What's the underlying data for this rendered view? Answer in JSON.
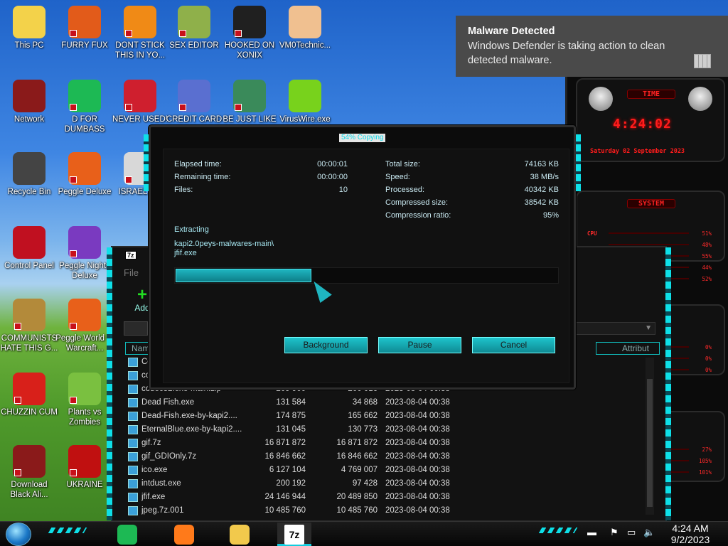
{
  "desktop_icons": [
    {
      "label": "This PC",
      "color": "#f3d24a",
      "shortcut": false
    },
    {
      "label": "FURRY FUX",
      "color": "#e25b1a",
      "shortcut": true
    },
    {
      "label": "DONT STICK THIS IN YO...",
      "color": "#f08a16",
      "shortcut": true
    },
    {
      "label": "SEX EDITOR",
      "color": "#8fb04a",
      "shortcut": true
    },
    {
      "label": "HOOKED ON XONIX",
      "color": "#202020",
      "shortcut": true
    },
    {
      "label": "VM0Technic...",
      "color": "#f0c090",
      "shortcut": false
    },
    {
      "label": "Network",
      "color": "#8a1a1a",
      "shortcut": false
    },
    {
      "label": "D FOR DUMBASS",
      "color": "#1db954",
      "shortcut": true
    },
    {
      "label": "NEVER USED!",
      "color": "#cf1f2e",
      "shortcut": true
    },
    {
      "label": "CREDIT CARD",
      "color": "#5a6fd0",
      "shortcut": true
    },
    {
      "label": "BE JUST LIKE",
      "color": "#3a8a5a",
      "shortcut": true
    },
    {
      "label": "VirusWire.exe",
      "color": "#78d21c",
      "shortcut": false
    },
    {
      "label": "Recycle Bin",
      "color": "#444444",
      "shortcut": false
    },
    {
      "label": "Peggle Deluxe",
      "color": "#e8601a",
      "shortcut": true
    },
    {
      "label": "ISRAEL S...",
      "color": "#d8d8d8",
      "shortcut": true
    },
    {
      "label": "Control Panel",
      "color": "#c01020",
      "shortcut": false
    },
    {
      "label": "Peggle Nights Deluxe",
      "color": "#7a3ac0",
      "shortcut": true
    },
    {
      "label": "COMMUNISTS HATE THIS G...",
      "color": "#b38a3a",
      "shortcut": true
    },
    {
      "label": "Peggle World of Warcraft...",
      "color": "#e8601a",
      "shortcut": true
    },
    {
      "label": "CHUZZIN CUM",
      "color": "#d8201a",
      "shortcut": true
    },
    {
      "label": "Plants vs Zombies",
      "color": "#7ac040",
      "shortcut": true
    },
    {
      "label": "Download Black Ali...",
      "color": "#8a1a1a",
      "shortcut": true
    },
    {
      "label": "UKRAINE",
      "color": "#c01010",
      "shortcut": true
    }
  ],
  "notification": {
    "title": "Malware Detected",
    "body": "Windows Defender is taking action to clean detected malware."
  },
  "gadget": {
    "time_label": "TIME",
    "clock": "4:24:02",
    "date": "Saturday 02 September 2023",
    "system_label": "SYSTEM",
    "cpu_label": "CPU",
    "rows": [
      {
        "label": "CPU",
        "value": "51%"
      },
      {
        "label": "",
        "value": "48%"
      },
      {
        "label": "",
        "value": "55%"
      },
      {
        "label": "",
        "value": "44%"
      },
      {
        "label": "",
        "value": "52%"
      },
      {
        "label": "",
        "value": "0%"
      },
      {
        "label": "",
        "value": "0%"
      },
      {
        "label": "",
        "value": "0%"
      },
      {
        "label": "",
        "value": "27%"
      },
      {
        "label": "",
        "value": "105%"
      },
      {
        "label": "",
        "value": "101%"
      }
    ]
  },
  "file_manager": {
    "app_badge": "7z",
    "menu_first": "File",
    "add_label": "Add",
    "col_name": "Name",
    "col_attrib": "Attribut",
    "files": [
      {
        "name": "Co...",
        "size": "",
        "packed": "",
        "modified": ""
      },
      {
        "name": "co...",
        "size": "",
        "packed": "",
        "modified": ""
      },
      {
        "name": "codec32.exe-main.zip",
        "size": "209 900",
        "packed": "200 016",
        "modified": "2023-08-04 00:38"
      },
      {
        "name": "Dead Fish.exe",
        "size": "131 584",
        "packed": "34 868",
        "modified": "2023-08-04 00:38"
      },
      {
        "name": "Dead-Fish.exe-by-kapi2....",
        "size": "174 875",
        "packed": "165 662",
        "modified": "2023-08-04 00:38"
      },
      {
        "name": "EternalBlue.exe-by-kapi2....",
        "size": "131 045",
        "packed": "130 773",
        "modified": "2023-08-04 00:38"
      },
      {
        "name": "gif.7z",
        "size": "16 871 872",
        "packed": "16 871 872",
        "modified": "2023-08-04 00:38"
      },
      {
        "name": "gif_GDIOnly.7z",
        "size": "16 846 662",
        "packed": "16 846 662",
        "modified": "2023-08-04 00:38"
      },
      {
        "name": "ico.exe",
        "size": "6 127 104",
        "packed": "4 769 007",
        "modified": "2023-08-04 00:38"
      },
      {
        "name": "intdust.exe",
        "size": "200 192",
        "packed": "97 428",
        "modified": "2023-08-04 00:38"
      },
      {
        "name": "jfif.exe",
        "size": "24 146 944",
        "packed": "20 489 850",
        "modified": "2023-08-04 00:38"
      },
      {
        "name": "jpeg.7z.001",
        "size": "10 485 760",
        "packed": "10 485 760",
        "modified": "2023-08-04 00:38"
      }
    ]
  },
  "progress": {
    "title": "54% Copying",
    "elapsed_label": "Elapsed time:",
    "elapsed": "00:00:01",
    "remaining_label": "Remaining time:",
    "remaining": "00:00:00",
    "files_label": "Files:",
    "files": "10",
    "total_label": "Total size:",
    "total": "74163 KB",
    "speed_label": "Speed:",
    "speed": "38 MB/s",
    "processed_label": "Processed:",
    "processed": "40342 KB",
    "compressed_label": "Compressed size:",
    "compressed": "38542 KB",
    "ratio_label": "Compression ratio:",
    "ratio": "95%",
    "action": "Extracting",
    "path_line1": "kapi2.0peys-malwares-main\\",
    "path_line2": "jfif.exe",
    "percent": 0.355,
    "background_btn": "Background",
    "pause_btn": "Pause",
    "cancel_btn": "Cancel"
  },
  "taskbar": {
    "time": "4:24 AM",
    "date": "9/2/2023",
    "active_app": "7z",
    "apps": [
      {
        "name": "spotify-icon",
        "color": "#1db954"
      },
      {
        "name": "firefox-icon",
        "color": "#ff7a1a"
      },
      {
        "name": "file-explorer-icon",
        "color": "#f2c94c"
      },
      {
        "name": "7zip-icon",
        "color": "#ffffff"
      }
    ]
  },
  "colors": {
    "accent": "#0ee0e8",
    "gadget_red": "#ff1c1c"
  }
}
